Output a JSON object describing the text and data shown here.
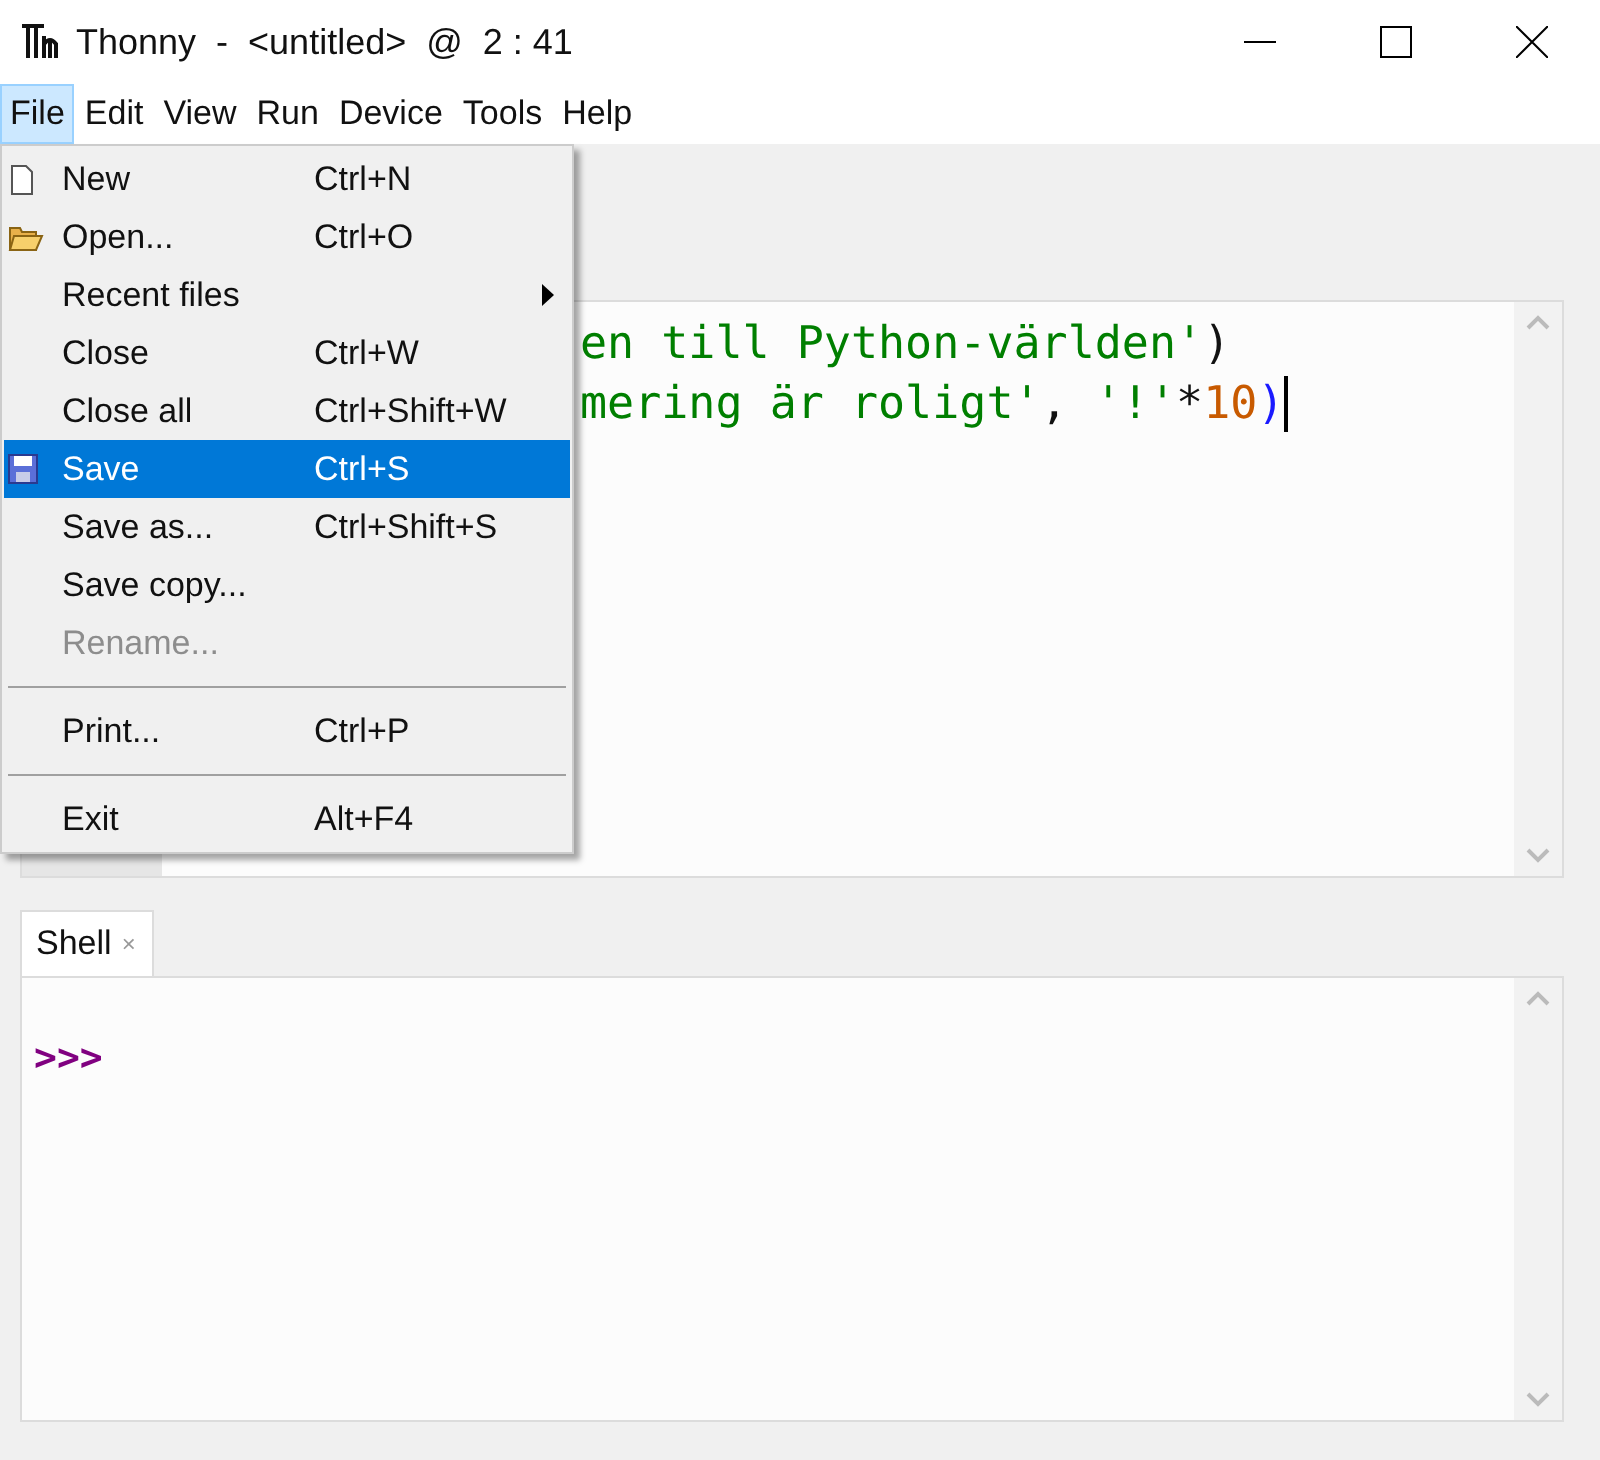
{
  "window": {
    "title": "Thonny  -  <untitled>  @  2 : 41"
  },
  "menubar": [
    {
      "label": "File",
      "selected": true
    },
    {
      "label": "Edit",
      "selected": false
    },
    {
      "label": "View",
      "selected": false
    },
    {
      "label": "Run",
      "selected": false
    },
    {
      "label": "Device",
      "selected": false
    },
    {
      "label": "Tools",
      "selected": false
    },
    {
      "label": "Help",
      "selected": false
    }
  ],
  "file_menu": [
    {
      "kind": "item",
      "label": "New",
      "shortcut": "Ctrl+N",
      "selected": false,
      "disabled": false
    },
    {
      "kind": "item",
      "label": "Open...",
      "shortcut": "Ctrl+O",
      "selected": false,
      "disabled": false
    },
    {
      "kind": "submenu",
      "label": "Recent files",
      "selected": false,
      "disabled": false
    },
    {
      "kind": "item",
      "label": "Close",
      "shortcut": "Ctrl+W",
      "selected": false,
      "disabled": false
    },
    {
      "kind": "item",
      "label": "Close all",
      "shortcut": "Ctrl+Shift+W",
      "selected": false,
      "disabled": false
    },
    {
      "kind": "item",
      "label": "Save",
      "shortcut": "Ctrl+S",
      "selected": true,
      "disabled": false
    },
    {
      "kind": "item",
      "label": "Save as...",
      "shortcut": "Ctrl+Shift+S",
      "selected": false,
      "disabled": false
    },
    {
      "kind": "item",
      "label": "Save copy...",
      "selected": false,
      "disabled": false
    },
    {
      "kind": "item",
      "label": "Rename...",
      "selected": false,
      "disabled": true
    },
    {
      "kind": "separator"
    },
    {
      "kind": "item",
      "label": "Print...",
      "shortcut": "Ctrl+P",
      "selected": false,
      "disabled": false
    },
    {
      "kind": "separator"
    },
    {
      "kind": "item",
      "label": "Exit",
      "shortcut": "Alt+F4",
      "selected": false,
      "disabled": false
    }
  ],
  "editor": {
    "lines": [
      [
        {
          "kind": "string",
          "text": "en till Python-världen'"
        },
        {
          "kind": "plain",
          "text": ")"
        }
      ],
      [
        {
          "kind": "string",
          "text": "mering är roligt'"
        },
        {
          "kind": "plain",
          "text": ", "
        },
        {
          "kind": "string",
          "text": "'!'"
        },
        {
          "kind": "plain",
          "text": "*"
        },
        {
          "kind": "number",
          "text": "10"
        },
        {
          "kind": "paren",
          "text": ")"
        }
      ]
    ]
  },
  "shell": {
    "tab": {
      "label": "Shell",
      "close": "×"
    },
    "prompt": ">>>"
  }
}
